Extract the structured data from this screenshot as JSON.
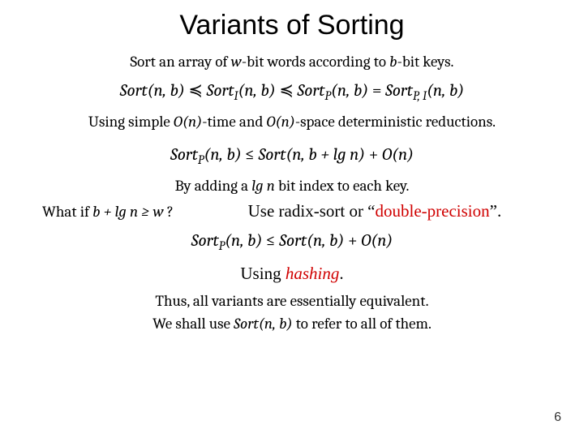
{
  "title": "Variants of Sorting",
  "line1_a": "Sort an array of ",
  "line1_b": "-bit words according to ",
  "line1_c": "-bit keys.",
  "w": "w",
  "b": "b",
  "formula1": {
    "s1": "Sort",
    "arg1": "(n, b)",
    "op1": " ≼ ",
    "s2": "Sort",
    "sub2": "I",
    "arg2": "(n, b)",
    "op2": " ≼ ",
    "s3": "Sort",
    "sub3": "P",
    "arg3": "(n, b)",
    "eq": " = ",
    "s4": "Sort",
    "sub4": "P, I",
    "arg4": "(n, b)"
  },
  "line2_a": "Using simple ",
  "line2_b": "-time and ",
  "line2_c": "-space deterministic reductions.",
  "On": "O(n)",
  "formula2": {
    "s1": "Sort",
    "sub1": "P",
    "arg1": "(n, b)",
    "le": " ≤ ",
    "s2": "Sort",
    "arg2": "(n, b + lg n)",
    "plus": " + ",
    "On": "O(n)"
  },
  "line3_a": "By adding a ",
  "lgn": "lg n",
  "line3_b": " bit index to each key.",
  "whatif_prefix": "What if ",
  "whatif_cond": "b + lg n ≥ w",
  "whatif_q": " ?",
  "answer_a": "Use radix-sort or  “",
  "answer_red": "double-precision",
  "answer_b": "”.",
  "formula3": {
    "s1": "Sort",
    "sub1": "P",
    "arg1": "(n, b)",
    "le": " ≤ ",
    "s2": "Sort",
    "arg2": "(n, b)",
    "plus": " + ",
    "On": "O(n)"
  },
  "hashing_a": "Using ",
  "hashing_b": "hashing",
  "hashing_c": ".",
  "closing1_a": "Thus, all variants are essentially equivalent.",
  "closing2_a": "We shall use ",
  "closing2_fn": "Sort",
  "closing2_arg": "(n, b)",
  "closing2_b": " to refer to all of them.",
  "page": "6"
}
